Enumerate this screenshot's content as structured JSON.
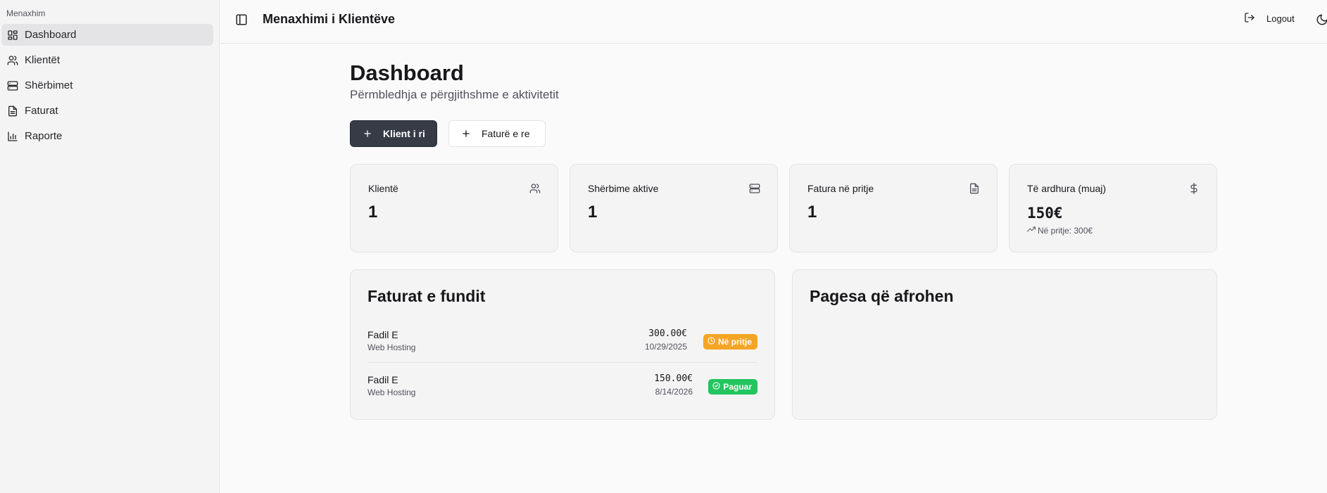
{
  "sidebar": {
    "group_label": "Menaxhim",
    "items": [
      {
        "label": "Dashboard",
        "icon": "layout-grid-icon",
        "active": true
      },
      {
        "label": "Klientët",
        "icon": "users-icon",
        "active": false
      },
      {
        "label": "Shërbimet",
        "icon": "server-icon",
        "active": false
      },
      {
        "label": "Faturat",
        "icon": "file-text-icon",
        "active": false
      },
      {
        "label": "Raporte",
        "icon": "bar-chart-icon",
        "active": false
      }
    ]
  },
  "header": {
    "title": "Menaxhimi i Klientëve",
    "logout_label": "Logout"
  },
  "main": {
    "title": "Dashboard",
    "subtitle": "Përmbledhja e përgjithshme e aktivitetit",
    "actions": {
      "new_client": "Klient i ri",
      "new_invoice": "Faturë e re"
    },
    "stats": [
      {
        "label": "Klientë",
        "value": "1",
        "icon": "users-icon"
      },
      {
        "label": "Shërbime aktive",
        "value": "1",
        "icon": "server-icon"
      },
      {
        "label": "Fatura në pritje",
        "value": "1",
        "icon": "file-text-icon"
      },
      {
        "label": "Të ardhura (muaj)",
        "value": "150€",
        "icon": "dollar-icon",
        "note": "Në pritje: 300€"
      }
    ],
    "recent_invoices": {
      "title": "Faturat e fundit",
      "rows": [
        {
          "client": "Fadil E",
          "service": "Web Hosting",
          "amount": "300.00€",
          "date": "10/29/2025",
          "status": "Në pritje",
          "status_color": "#f5a524"
        },
        {
          "client": "Fadil E",
          "service": "Web Hosting",
          "amount": "150.00€",
          "date": "8/14/2026",
          "status": "Paguar",
          "status_color": "#22c55e"
        }
      ]
    },
    "upcoming_payments": {
      "title": "Pagesa që afrohen"
    }
  },
  "colors": {
    "primary_button": "#363b46",
    "pending": "#f5a524",
    "paid": "#22c55e"
  }
}
